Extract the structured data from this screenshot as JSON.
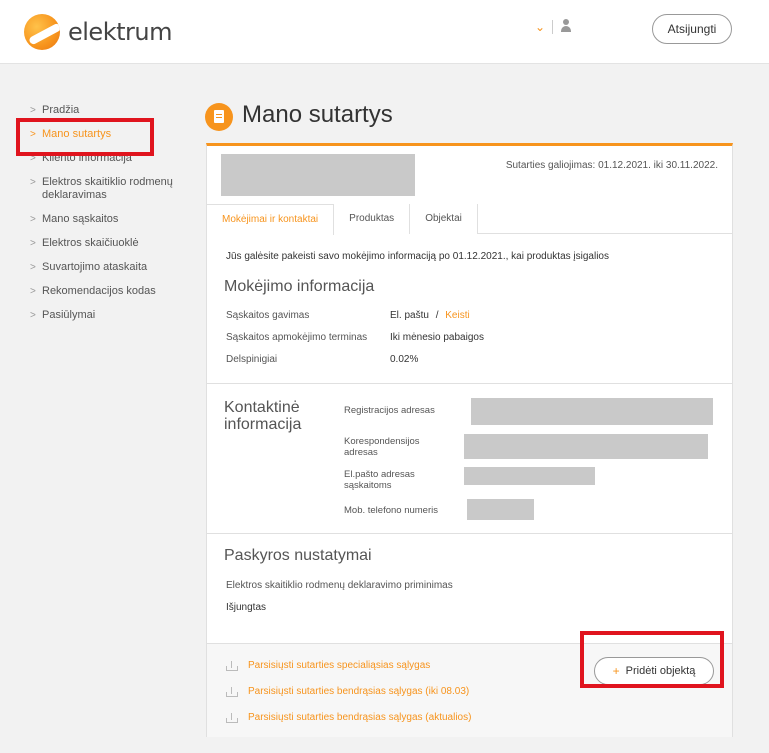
{
  "header": {
    "logo_text": "elektrum",
    "logout_label": "Atsijungti",
    "user_menu_icon": "user-icon",
    "dropdown_icon": "chevron-down-icon"
  },
  "sidebar": {
    "items": [
      {
        "label": "Pradžia"
      },
      {
        "label": "Mano sutartys",
        "active": true
      },
      {
        "label": "Kliento informacija"
      },
      {
        "label": "Elektros skaitiklio rodmenų deklaravimas"
      },
      {
        "label": "Mano sąskaitos"
      },
      {
        "label": "Elektros skaičiuoklė"
      },
      {
        "label": "Suvartojimo ataskaita"
      },
      {
        "label": "Rekomendacijos kodas"
      },
      {
        "label": "Pasiūlymai"
      }
    ]
  },
  "page": {
    "title": "Mano sutartys"
  },
  "contract": {
    "validity": "Sutarties galiojimas: 01.12.2021. iki 30.11.2022.",
    "tabs": [
      "Mokėjimai ir kontaktai",
      "Produktas",
      "Objektai"
    ],
    "notice": "Jūs galėsite pakeisti savo mokėjimo informaciją po 01.12.2021., kai produktas įsigalios",
    "payment": {
      "title": "Mokėjimo informacija",
      "rows": [
        {
          "label": "Sąskaitos gavimas",
          "value": "El. paštu",
          "sep": "/",
          "link": "Keisti"
        },
        {
          "label": "Sąskaitos apmokėjimo terminas",
          "value": "Iki mėnesio pabaigos"
        },
        {
          "label": "Delspinigiai",
          "value": "0.02%"
        }
      ]
    },
    "contact": {
      "title": "Kontaktinė informacija",
      "title_line1": "Kontaktinė",
      "title_line2": "informacija",
      "reg_address": "Registracijos adresas",
      "corr_address_l1": "Korespondensijos",
      "corr_address_l2": "adresas",
      "email_l1": "El.pašto adresas",
      "email_l2": "sąskaitoms",
      "phone": "Mob. telefono numeris"
    },
    "account": {
      "title": "Paskyros nustatymai",
      "reminder_label": "Elektros skaitiklio rodmenų deklaravimo priminimas",
      "reminder_value": "Išjungtas"
    },
    "downloads": [
      "Parsisiųsti sutarties specialiąsias sąlygas",
      "Parsisiųsti sutarties bendrąsias sąlygas (iki 08.03)",
      "Parsisiųsti sutarties bendrąsias sąlygas (aktualios)"
    ],
    "add_object_label": "Pridėti objektą"
  }
}
